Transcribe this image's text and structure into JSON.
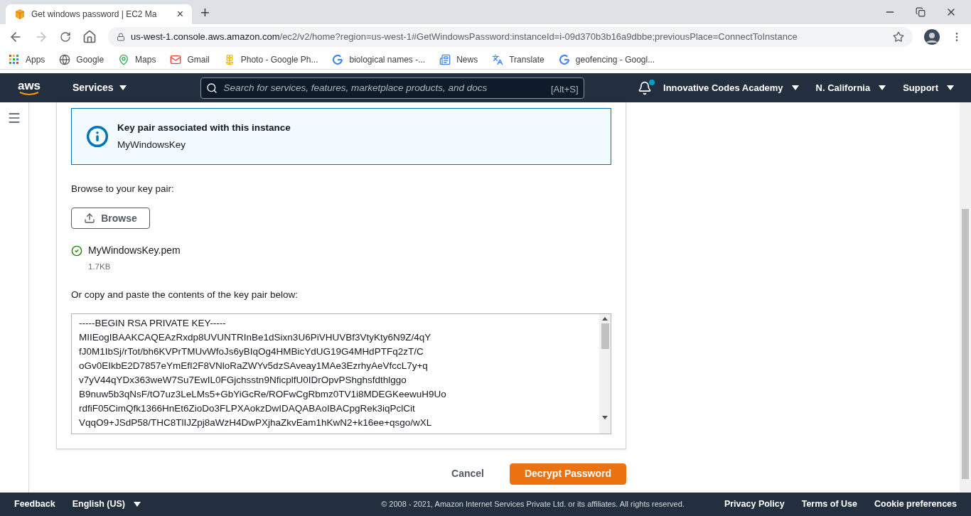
{
  "browser": {
    "tab": {
      "title": "Get windows password | EC2 Ma",
      "close": "×"
    },
    "new_tab": "+",
    "url_host": "us-west-1.console.aws.amazon.com",
    "url_path": "/ec2/v2/home?region=us-west-1#GetWindowsPassword:instanceId=i-09d370b3b16a9dbbe;previousPlace=ConnectToInstance",
    "bookmarks": [
      {
        "label": "Apps",
        "kind": "apps"
      },
      {
        "label": "Google",
        "kind": "globe"
      },
      {
        "label": "Maps",
        "kind": "maps"
      },
      {
        "label": "Gmail",
        "kind": "gmail"
      },
      {
        "label": "Photo - Google Ph...",
        "kind": "photos"
      },
      {
        "label": "biological names -...",
        "kind": "google"
      },
      {
        "label": "News",
        "kind": "news"
      },
      {
        "label": "Translate",
        "kind": "translate"
      },
      {
        "label": "geofencing - Googl...",
        "kind": "google"
      }
    ]
  },
  "aws_nav": {
    "logo": "aws",
    "services": "Services",
    "search_placeholder": "Search for services, features, marketplace products, and docs",
    "shortcut": "[Alt+S]",
    "notification_dot": true,
    "account": "Innovative Codes Academy",
    "region": "N. California",
    "support": "Support"
  },
  "info_box": {
    "title": "Key pair associated with this instance",
    "value": "MyWindowsKey"
  },
  "browse_label": "Browse to your key pair:",
  "browse_button": "Browse",
  "file": {
    "name": "MyWindowsKey.pem",
    "size": "1.7KB"
  },
  "paste_label": "Or copy and paste the contents of the key pair below:",
  "key_lines": [
    "-----BEGIN RSA PRIVATE KEY-----",
    "MIIEogIBAAKCAQEAzRxdp8UVUNTRInBe1dSixn3U6PiVHUVBf3VtyKty6N9Z/4qY",
    "fJ0M1IbSj/rTot/bh6KVPrTMUvWfoJs6yBIqOg4HMBicYdUG19G4MHdPTFq2zT/C",
    "oGv0EIkbE2D7857eYmEfI2F8VNloRaZWYv5dzSAveay1MAe3EzrhyAeVfccL7y+q",
    "v7yV44qYDx363weW7Su7EwIL0FGjchsstn9NficplfU0IDrOpvPShghsfdthlggo",
    "B9nuw5b3qNsF/tO7uz3LeLMs5+GbYiGcRe/ROFwCgRbmz0TV1i8MDEGKeewuH9Uo",
    "rdfiF05CimQfk1366HnEt6ZioDo3FLPXAokzDwIDAQABAoIBACpgRek3iqPclCit",
    "VqqO9+JSdP58/THC8TlIJZpj8aWzH4DwPXjhaZkvEam1hKwN2+k16ee+qsgo/wXL"
  ],
  "actions": {
    "cancel": "Cancel",
    "decrypt": "Decrypt Password"
  },
  "footer": {
    "feedback": "Feedback",
    "language": "English (US)",
    "copyright": "© 2008 - 2021, Amazon Internet Services Private Ltd. or its affiliates. All rights reserved.",
    "links": [
      "Privacy Policy",
      "Terms of Use",
      "Cookie preferences"
    ]
  }
}
